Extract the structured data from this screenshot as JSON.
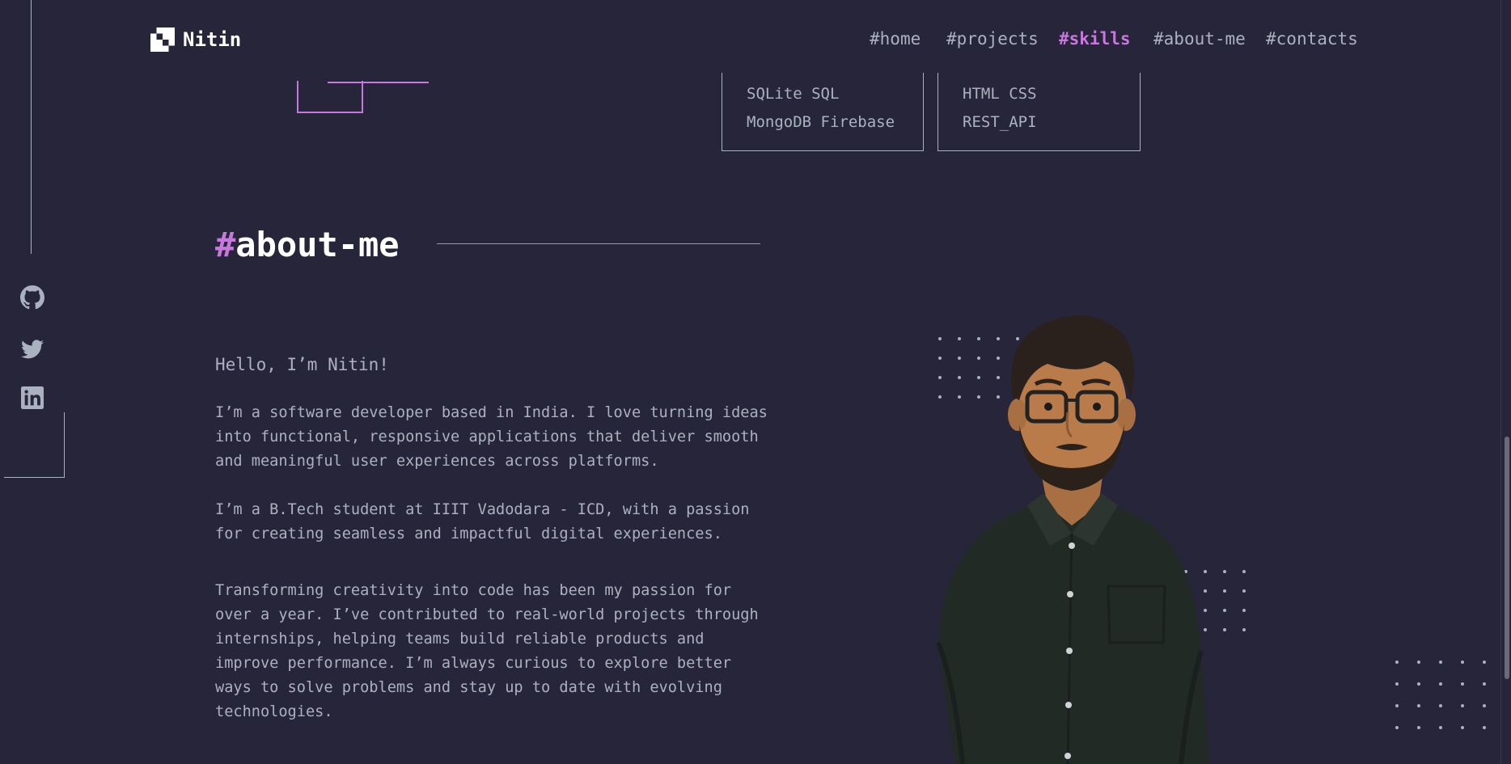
{
  "brand": {
    "name": "Nitin"
  },
  "nav": [
    {
      "hash": "#",
      "label": "home",
      "active": false
    },
    {
      "hash": "#",
      "label": "projects",
      "active": false
    },
    {
      "hash": "#",
      "label": "skills",
      "active": true
    },
    {
      "hash": "#",
      "label": "about-me",
      "active": false
    },
    {
      "hash": "#",
      "label": "contacts",
      "active": false
    }
  ],
  "social": [
    "github-icon",
    "twitter-icon",
    "linkedin-icon"
  ],
  "skills": {
    "databases": {
      "line1": "SQLite  SQL",
      "line2": "MongoDB  Firebase"
    },
    "other": {
      "line1": "HTML  CSS",
      "line2": "REST_API"
    }
  },
  "about": {
    "title_hash": "#",
    "title": "about-me",
    "hello": "Hello, I’m Nitin!",
    "p1": "I’m a software developer based in India. I love turning ideas\ninto functional, responsive applications that deliver smooth\nand meaningful user experiences across platforms.",
    "p2": "I’m a B.Tech student at IIIT Vadodara - ICD, with a passion\nfor creating seamless and impactful digital experiences.",
    "p3": "Transforming creativity into code has been my passion for\nover a year. I’ve contributed to real-world projects through\ninternships, helping teams build reliable products and\nimprove performance. I’m always curious to explore better\nways to solve problems and stay up to date with evolving\ntechnologies."
  },
  "colors": {
    "accent": "#C778DD",
    "background": "#27253a",
    "text": "#ABB2BF",
    "heading": "#FFFFFF"
  }
}
